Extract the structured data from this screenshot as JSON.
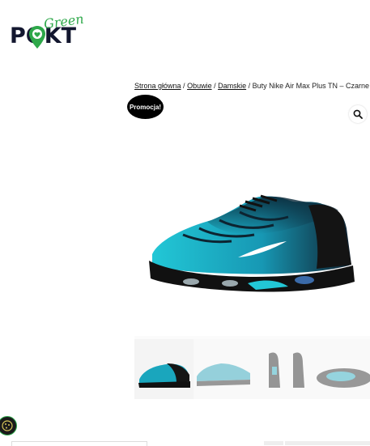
{
  "logo": {
    "word": "POKT",
    "script": "Green"
  },
  "breadcrumb": {
    "home": "Strona główna",
    "sep1": " / ",
    "category": "Obuwie",
    "sep2": " / ",
    "subcategory": "Damskie",
    "sep3": " / ",
    "current": "Buty Nike Air Max Plus TN – Czarne Li"
  },
  "product": {
    "badge": "Promocja!",
    "zoom_icon": "search-icon",
    "thumbnails": 4,
    "colors": {
      "teal": "#1fb6c9",
      "black": "#141414",
      "badge": "#000000",
      "brand_green": "#2ea84a",
      "brand_navy": "#13172f"
    }
  },
  "cookie": {
    "icon": "cookie-icon"
  }
}
